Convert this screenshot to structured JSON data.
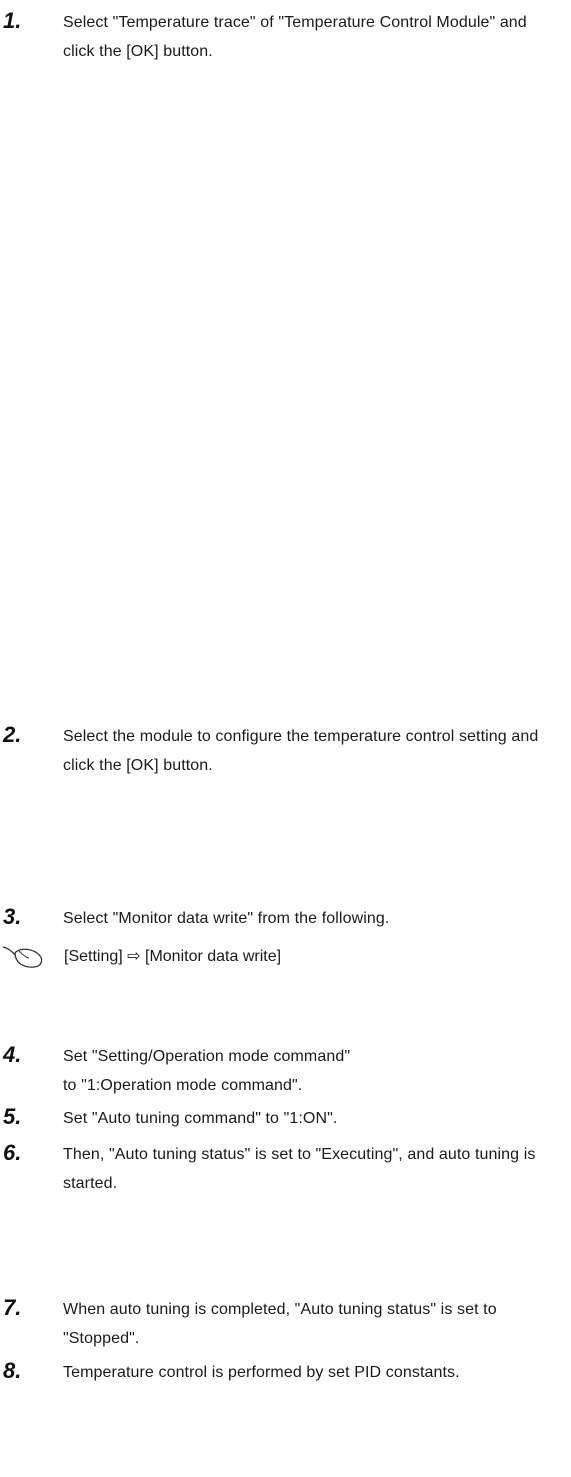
{
  "steps": [
    {
      "number": "1.",
      "text": "Select \"Temperature trace\" of \"Temperature Control Module\" and click the [OK] button."
    },
    {
      "number": "2.",
      "text": "Select the module to configure the temperature control setting and click the [OK] button."
    },
    {
      "number": "3.",
      "text": "Select \"Monitor data write\" from the following."
    },
    {
      "number": "4.",
      "text": "Set \"Setting/Operation mode command\" to \"1:Operation mode command\"."
    },
    {
      "number": "5.",
      "text": "Set \"Auto tuning command\" to \"1:ON\"."
    },
    {
      "number": "6.",
      "text": "Then, \"Auto tuning status\" is set to \"Executing\", and auto tuning is started."
    },
    {
      "number": "7.",
      "text": "When auto tuning is completed, \"Auto tuning status\" is set to \"Stopped\"."
    },
    {
      "number": "8.",
      "text": "Temperature control is performed by set PID constants."
    }
  ],
  "menu_path": {
    "icon": "mouse-icon",
    "text": "[Setting] ⇨ [Monitor data write]"
  }
}
